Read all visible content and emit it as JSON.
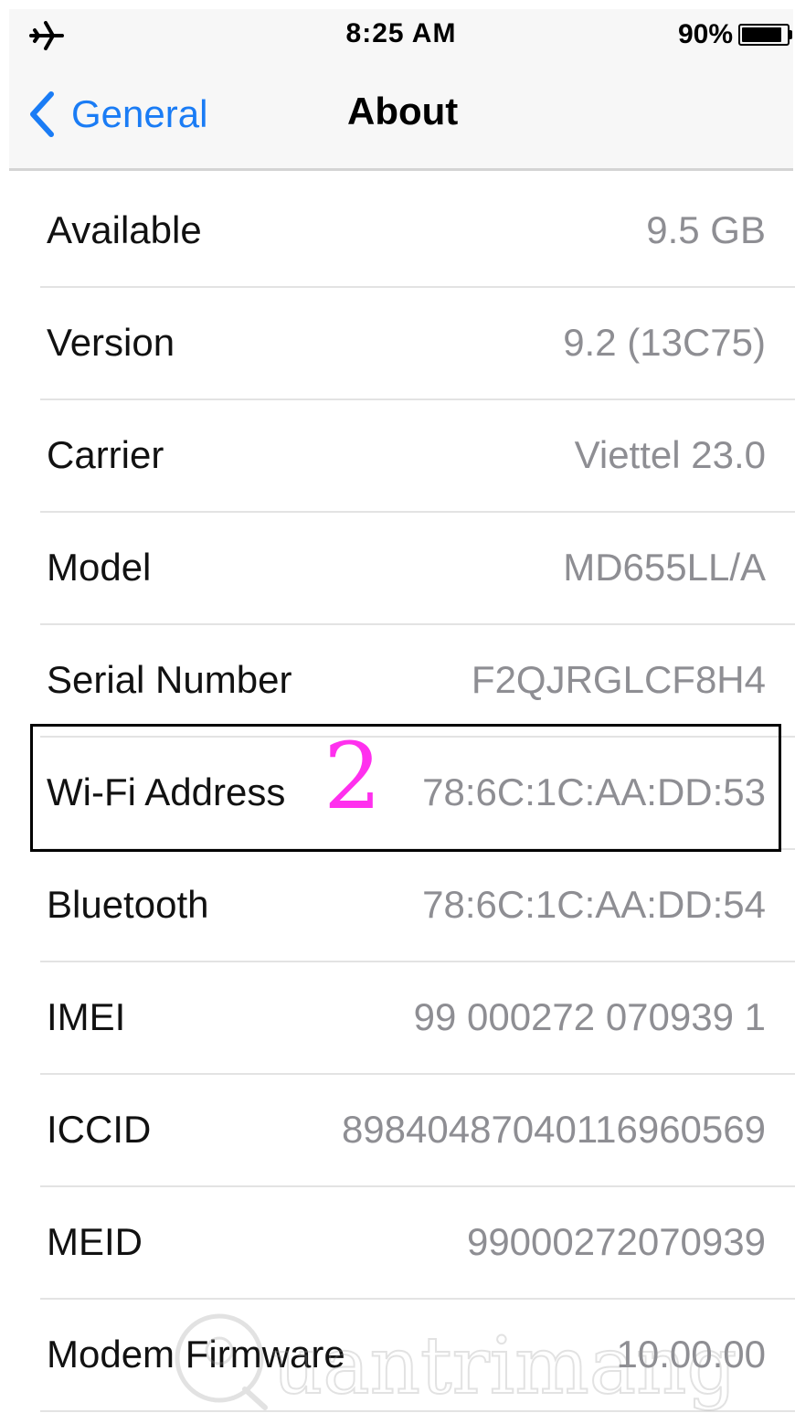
{
  "status_bar": {
    "time": "8:25 AM",
    "battery_percent_label": "90%",
    "battery_level": 0.9,
    "airplane_icon": "airplane-icon",
    "battery_icon": "battery-icon"
  },
  "nav": {
    "back_label": "General",
    "back_icon": "chevron-left-icon",
    "title": "About",
    "accent_color": "#1a7cf5"
  },
  "rows": [
    {
      "label": "Available",
      "value": "9.5 GB"
    },
    {
      "label": "Version",
      "value": "9.2 (13C75)"
    },
    {
      "label": "Carrier",
      "value": "Viettel 23.0"
    },
    {
      "label": "Model",
      "value": "MD655LL/A"
    },
    {
      "label": "Serial Number",
      "value": "F2QJRGLCF8H4"
    },
    {
      "label": "Wi-Fi Address",
      "value": "78:6C:1C:AA:DD:53"
    },
    {
      "label": "Bluetooth",
      "value": "78:6C:1C:AA:DD:54"
    },
    {
      "label": "IMEI",
      "value": "99 000272 070939 1"
    },
    {
      "label": "ICCID",
      "value": "8984048704011696056​9"
    },
    {
      "label": "MEID",
      "value": "99000272070939"
    },
    {
      "label": "Modem Firmware",
      "value": "10.00.00"
    }
  ],
  "annotation": {
    "number": "2",
    "color": "#ff30ee"
  },
  "watermark": {
    "text": "Quantrimang"
  }
}
